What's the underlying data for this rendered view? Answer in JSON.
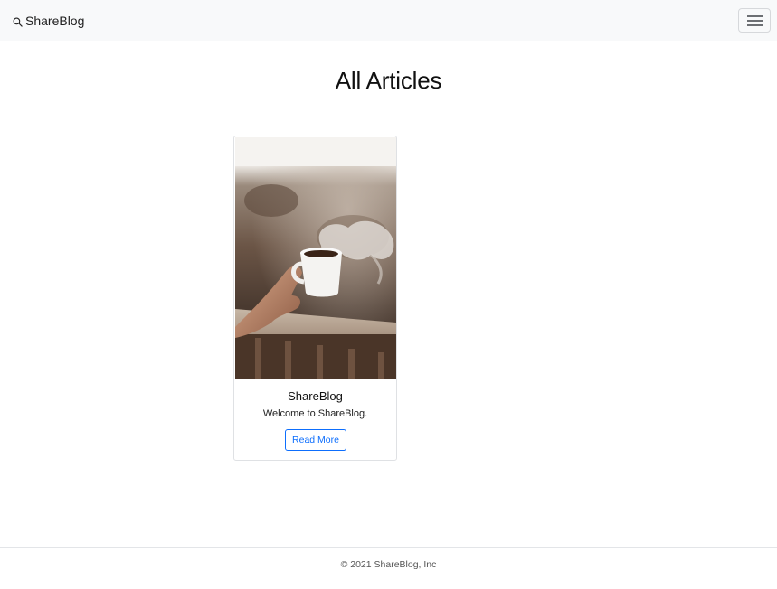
{
  "navbar": {
    "brand_icon": "search-icon",
    "brand_label": "ShareBlog",
    "toggler_icon": "hamburger-menu-icon"
  },
  "main": {
    "title": "All Articles",
    "articles": [
      {
        "image": "coffee-cup-photo",
        "title": "ShareBlog",
        "text": "Welcome to ShareBlog.",
        "button_label": "Read More"
      }
    ]
  },
  "footer": {
    "copyright": "© 2021 ShareBlog, Inc"
  },
  "colors": {
    "navbar_bg": "#f8f9fa",
    "link_blue": "#0d6efd",
    "border": "#dfe1e4"
  }
}
